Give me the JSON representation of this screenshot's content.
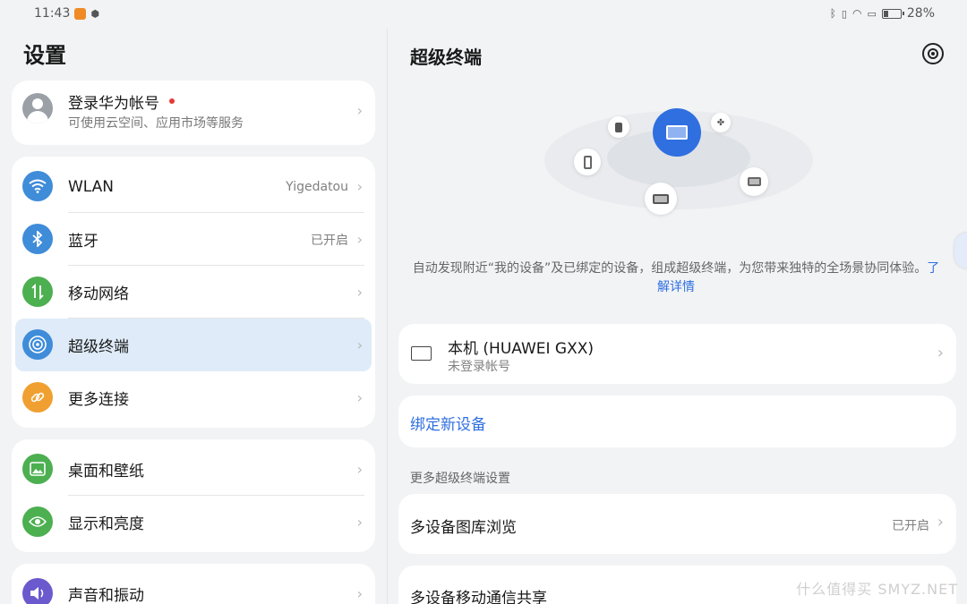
{
  "status": {
    "time": "11:43",
    "battery": "28%",
    "battery_level": 0.28
  },
  "left": {
    "title": "设置",
    "account": {
      "title": "登录华为帐号",
      "subtitle": "可使用云空间、应用市场等服务"
    },
    "group1": [
      {
        "label": "WLAN",
        "value": "Yigedatou",
        "icon": "wifi-icon",
        "color": "#3f8cd9"
      },
      {
        "label": "蓝牙",
        "value": "已开启",
        "icon": "bluetooth-icon",
        "color": "#3f8cd9"
      },
      {
        "label": "移动网络",
        "value": "",
        "icon": "mobile-data-icon",
        "color": "#4caf50"
      },
      {
        "label": "超级终端",
        "value": "",
        "icon": "super-device-icon",
        "color": "#3f8cd9"
      },
      {
        "label": "更多连接",
        "value": "",
        "icon": "link-icon",
        "color": "#f0a030"
      }
    ],
    "group2": [
      {
        "label": "桌面和壁纸",
        "icon": "wallpaper-icon",
        "color": "#4caf50"
      },
      {
        "label": "显示和亮度",
        "icon": "eye-icon",
        "color": "#4caf50"
      }
    ],
    "group3": [
      {
        "label": "声音和振动",
        "icon": "speaker-icon",
        "color": "#6a5acd"
      }
    ]
  },
  "right": {
    "title": "超级终端",
    "desc_main": "自动发现附近“我的设备”及已绑定的设备，组成超级终端，为您带来独特的全场景协同体验。",
    "desc_link": "了解详情",
    "this_device": {
      "title": "本机 (HUAWEI GXX)",
      "subtitle": "未登录帐号"
    },
    "bind_new": "绑定新设备",
    "more_settings": "更多超级终端设置",
    "gallery": {
      "label": "多设备图库浏览",
      "value": "已开启"
    },
    "mobile_share": {
      "label": "多设备移动通信共享"
    },
    "accent": "#2f6fe0"
  },
  "watermark": "什么值得买 SMYZ.NET"
}
